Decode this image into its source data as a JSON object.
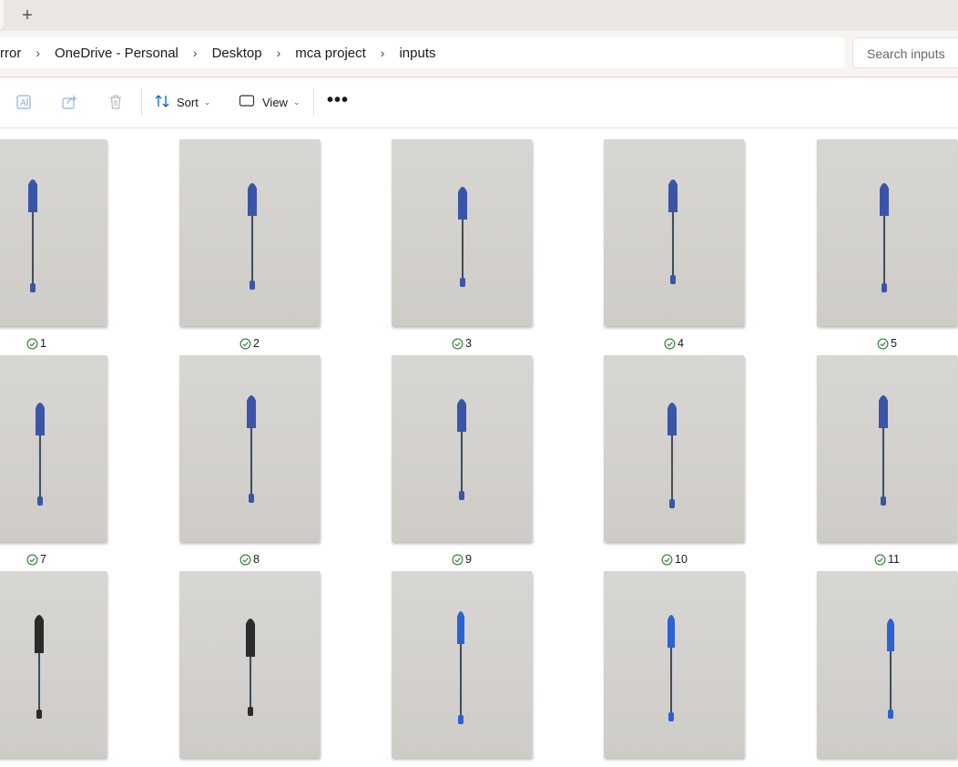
{
  "window": {
    "new_tab_symbol": "+"
  },
  "address_bar": {
    "breadcrumbs": [
      "rror",
      "OneDrive - Personal",
      "Desktop",
      "mca project",
      "inputs"
    ],
    "separator": "›"
  },
  "search": {
    "placeholder": "Search inputs"
  },
  "toolbar": {
    "icons": [
      "rename-icon",
      "share-icon",
      "delete-icon"
    ],
    "sort_label": "Sort",
    "view_label": "View",
    "more_symbol": "•••"
  },
  "files": [
    {
      "name": "1",
      "status": "synced",
      "pen": "blue"
    },
    {
      "name": "2",
      "status": "synced",
      "pen": "blue"
    },
    {
      "name": "3",
      "status": "synced",
      "pen": "blue"
    },
    {
      "name": "4",
      "status": "synced",
      "pen": "blue"
    },
    {
      "name": "5",
      "status": "synced",
      "pen": "blue"
    },
    {
      "name": "7",
      "status": "synced",
      "pen": "blue"
    },
    {
      "name": "8",
      "status": "synced",
      "pen": "blue"
    },
    {
      "name": "9",
      "status": "synced",
      "pen": "blue"
    },
    {
      "name": "10",
      "status": "synced",
      "pen": "blue"
    },
    {
      "name": "11",
      "status": "synced",
      "pen": "blue"
    },
    {
      "name": "",
      "status": "",
      "pen": "black"
    },
    {
      "name": "",
      "status": "",
      "pen": "black"
    },
    {
      "name": "",
      "status": "",
      "pen": "bright-blue"
    },
    {
      "name": "",
      "status": "",
      "pen": "bright-blue"
    },
    {
      "name": "",
      "status": "",
      "pen": "bright-blue"
    }
  ],
  "colors": {
    "accent": "#0067c0",
    "sync_check": "#2e7d32",
    "pen_blue": "#3a55a8",
    "pen_black": "#2b2b2b",
    "pen_bright_blue": "#2a62d6"
  }
}
